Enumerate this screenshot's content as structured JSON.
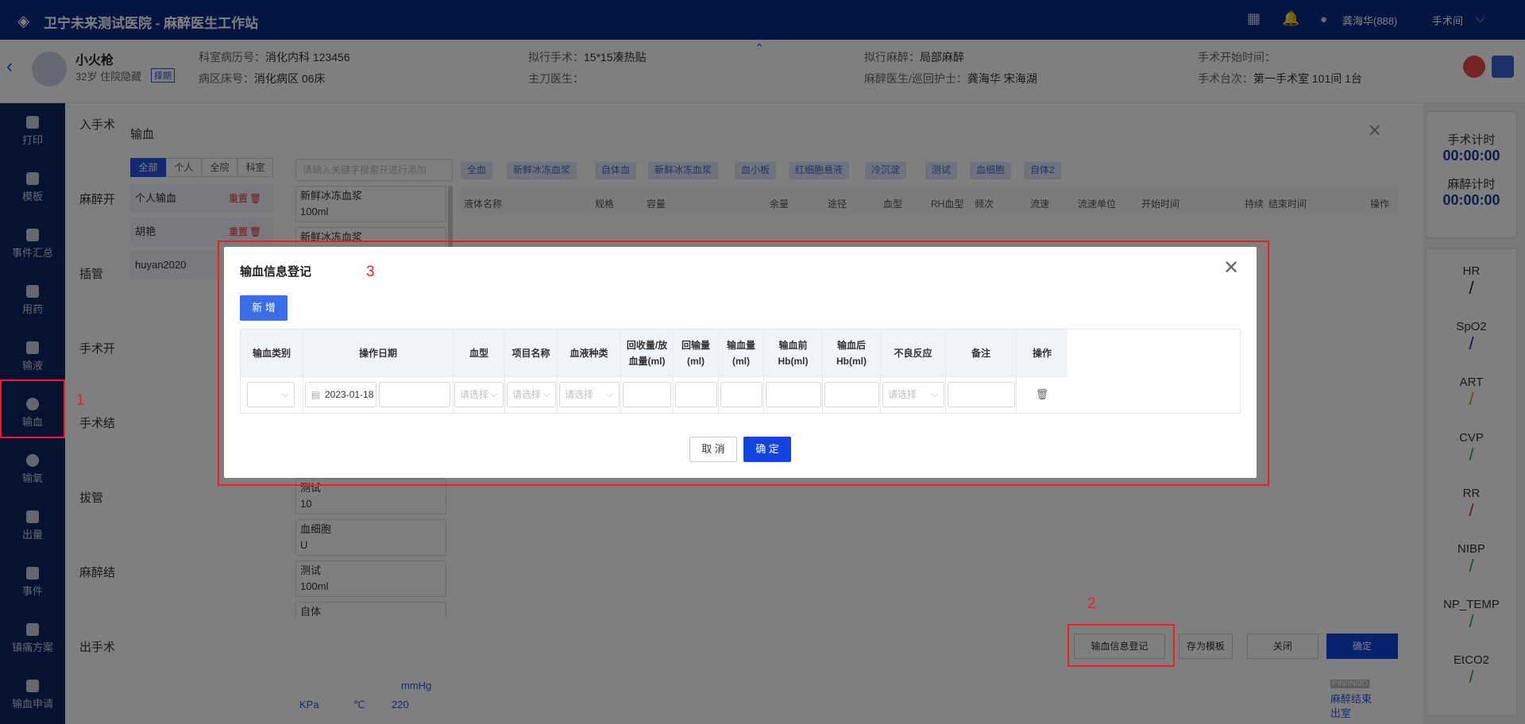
{
  "app": {
    "title": "卫宁未来测试医院 - 麻醉医生工作站",
    "user": "龚海华(888)",
    "room": "手术间"
  },
  "patient": {
    "name": "小火枪",
    "age_info": "32岁 住院隐藏",
    "tag": "择期",
    "f1": "科室病历号：",
    "v1": "消化内科 123456",
    "f2": "病区床号：",
    "v2": "消化病区 06床",
    "f3": "拟行手术：",
    "v3": "15*15凑热贴",
    "f4": "主刀医生：",
    "v4": "",
    "f5": "拟行麻醉：",
    "v5": "局部麻醉",
    "f6": "麻醉医生/巡回护士：",
    "v6": "龚海华 宋海湖",
    "f7": "手术开始时间：",
    "v7": "",
    "f8": "手术台次：",
    "v8": "第一手术室 101间 1台"
  },
  "sidebar": {
    "items": [
      "打印",
      "模板",
      "事件汇总",
      "用药",
      "输液",
      "输血",
      "输氧",
      "出量",
      "事件",
      "镇痛方案",
      "输血申请"
    ]
  },
  "stages": [
    "入手术",
    "麻醉开",
    "插管",
    "手术开",
    "手术结",
    "拔管",
    "麻醉结",
    "出手术"
  ],
  "right": {
    "op_timer_label": "手术计时",
    "op_timer": "00:00:00",
    "an_timer_label": "麻醉计时",
    "an_timer": "00:00:00",
    "vitals": [
      {
        "name": "HR",
        "color": "#222222"
      },
      {
        "name": "SpO2",
        "color": "#1a2aa0"
      },
      {
        "name": "ART",
        "color": "#e08a1a"
      },
      {
        "name": "CVP",
        "color": "#2aa050"
      },
      {
        "name": "RR",
        "color": "#d03030"
      },
      {
        "name": "NIBP",
        "color": "#2aa050"
      },
      {
        "name": "NP_TEMP",
        "color": "#2aa050"
      },
      {
        "name": "EtCO2",
        "color": "#2aa050"
      }
    ]
  },
  "bt": {
    "title": "输血",
    "tabs": [
      "全部",
      "个人",
      "全院",
      "科室"
    ],
    "templates": [
      {
        "name": "个人输血",
        "rename": "重置"
      },
      {
        "name": "胡艳",
        "rename": "重置"
      },
      {
        "name": "huyan2020",
        "rename": ""
      }
    ],
    "search_placeholder": "请输入关键字搜索开进行添加",
    "products": [
      {
        "name": "新鲜冰冻血浆",
        "sub": "100ml"
      },
      {
        "name": "新鲜冰冻血浆",
        "sub": ""
      },
      {
        "name": "测试",
        "sub": "10"
      },
      {
        "name": "血细胞",
        "sub": "U"
      },
      {
        "name": "测试",
        "sub": "100ml"
      },
      {
        "name": "自体",
        "sub": ""
      }
    ],
    "chips": [
      "全血",
      "新鲜冰冻血浆",
      "自体血",
      "新鲜冰冻血浆",
      "血小板",
      "红细胞悬液",
      "冷沉淀",
      "测试",
      "血细胞",
      "自体2"
    ],
    "grid_headers": [
      "液体名称",
      "规格",
      "容量",
      "余量",
      "途径",
      "血型",
      "RH血型",
      "频次",
      "流速",
      "流速单位",
      "开始时间",
      "持续",
      "结束时间",
      "操作"
    ],
    "btn_register": "输血信息登记",
    "btn_template": "存为模板",
    "btn_close": "关闭",
    "btn_confirm": "确定"
  },
  "modal": {
    "title": "输血信息登记",
    "add": "新 增",
    "headers": [
      "输血类别",
      "操作日期",
      "血型",
      "项目名称",
      "血液种类",
      "回收量/放血量(ml)",
      "回输量(ml)",
      "输血量(ml)",
      "输血前Hb(ml)",
      "输血后Hb(ml)",
      "不良反应",
      "备注",
      "操作"
    ],
    "row": {
      "date": "2023-01-18",
      "ph": "请选择"
    },
    "cancel": "取 消",
    "ok": "确 定"
  },
  "chart_strip": {
    "unit1": "mmHg",
    "unit2": "KPa",
    "unit3": "℃",
    "val": "220",
    "l1": "麻醉结束",
    "l2": "出室",
    "l3": "PIN/IN/3D"
  },
  "annotations": [
    "1",
    "2",
    "3"
  ]
}
